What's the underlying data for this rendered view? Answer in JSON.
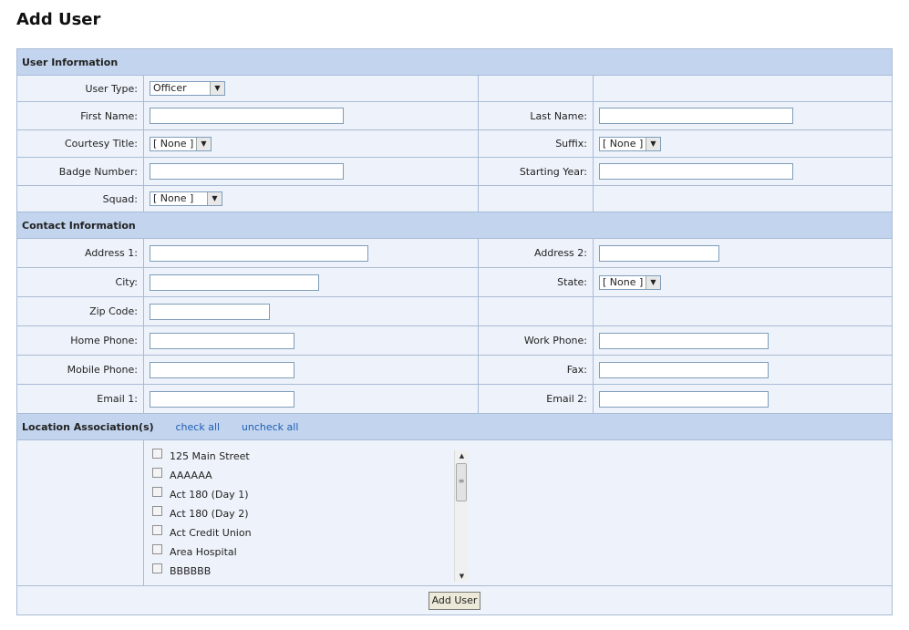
{
  "page": {
    "title": "Add User"
  },
  "sections": {
    "user_info": "User Information",
    "contact_info": "Contact Information",
    "location": "Location Association(s)",
    "check_all": "check all",
    "uncheck_all": "uncheck all"
  },
  "fields": {
    "user_type": {
      "label": "User Type:",
      "value": "Officer"
    },
    "first_name": {
      "label": "First Name:",
      "value": ""
    },
    "last_name": {
      "label": "Last Name:",
      "value": ""
    },
    "courtesy_title": {
      "label": "Courtesy Title:",
      "value": "[ None ]"
    },
    "suffix": {
      "label": "Suffix:",
      "value": "[ None ]"
    },
    "badge_number": {
      "label": "Badge Number:",
      "value": ""
    },
    "starting_year": {
      "label": "Starting Year:",
      "value": ""
    },
    "squad": {
      "label": "Squad:",
      "value": "[ None ]"
    },
    "address1": {
      "label": "Address 1:",
      "value": ""
    },
    "address2": {
      "label": "Address 2:",
      "value": ""
    },
    "city": {
      "label": "City:",
      "value": ""
    },
    "state": {
      "label": "State:",
      "value": "[ None ]"
    },
    "zip": {
      "label": "Zip Code:",
      "value": ""
    },
    "home_phone": {
      "label": "Home Phone:",
      "value": ""
    },
    "work_phone": {
      "label": "Work Phone:",
      "value": ""
    },
    "mobile_phone": {
      "label": "Mobile Phone:",
      "value": ""
    },
    "fax": {
      "label": "Fax:",
      "value": ""
    },
    "email1": {
      "label": "Email 1:",
      "value": ""
    },
    "email2": {
      "label": "Email 2:",
      "value": ""
    }
  },
  "locations": [
    {
      "label": "125 Main Street",
      "checked": false
    },
    {
      "label": "AAAAAA",
      "checked": false
    },
    {
      "label": "Act 180 (Day 1)",
      "checked": false
    },
    {
      "label": "Act 180 (Day 2)",
      "checked": false
    },
    {
      "label": "Act Credit Union",
      "checked": false
    },
    {
      "label": "Area Hospital",
      "checked": false
    },
    {
      "label": "BBBBBB",
      "checked": false
    }
  ],
  "actions": {
    "add_user": "Add User"
  }
}
